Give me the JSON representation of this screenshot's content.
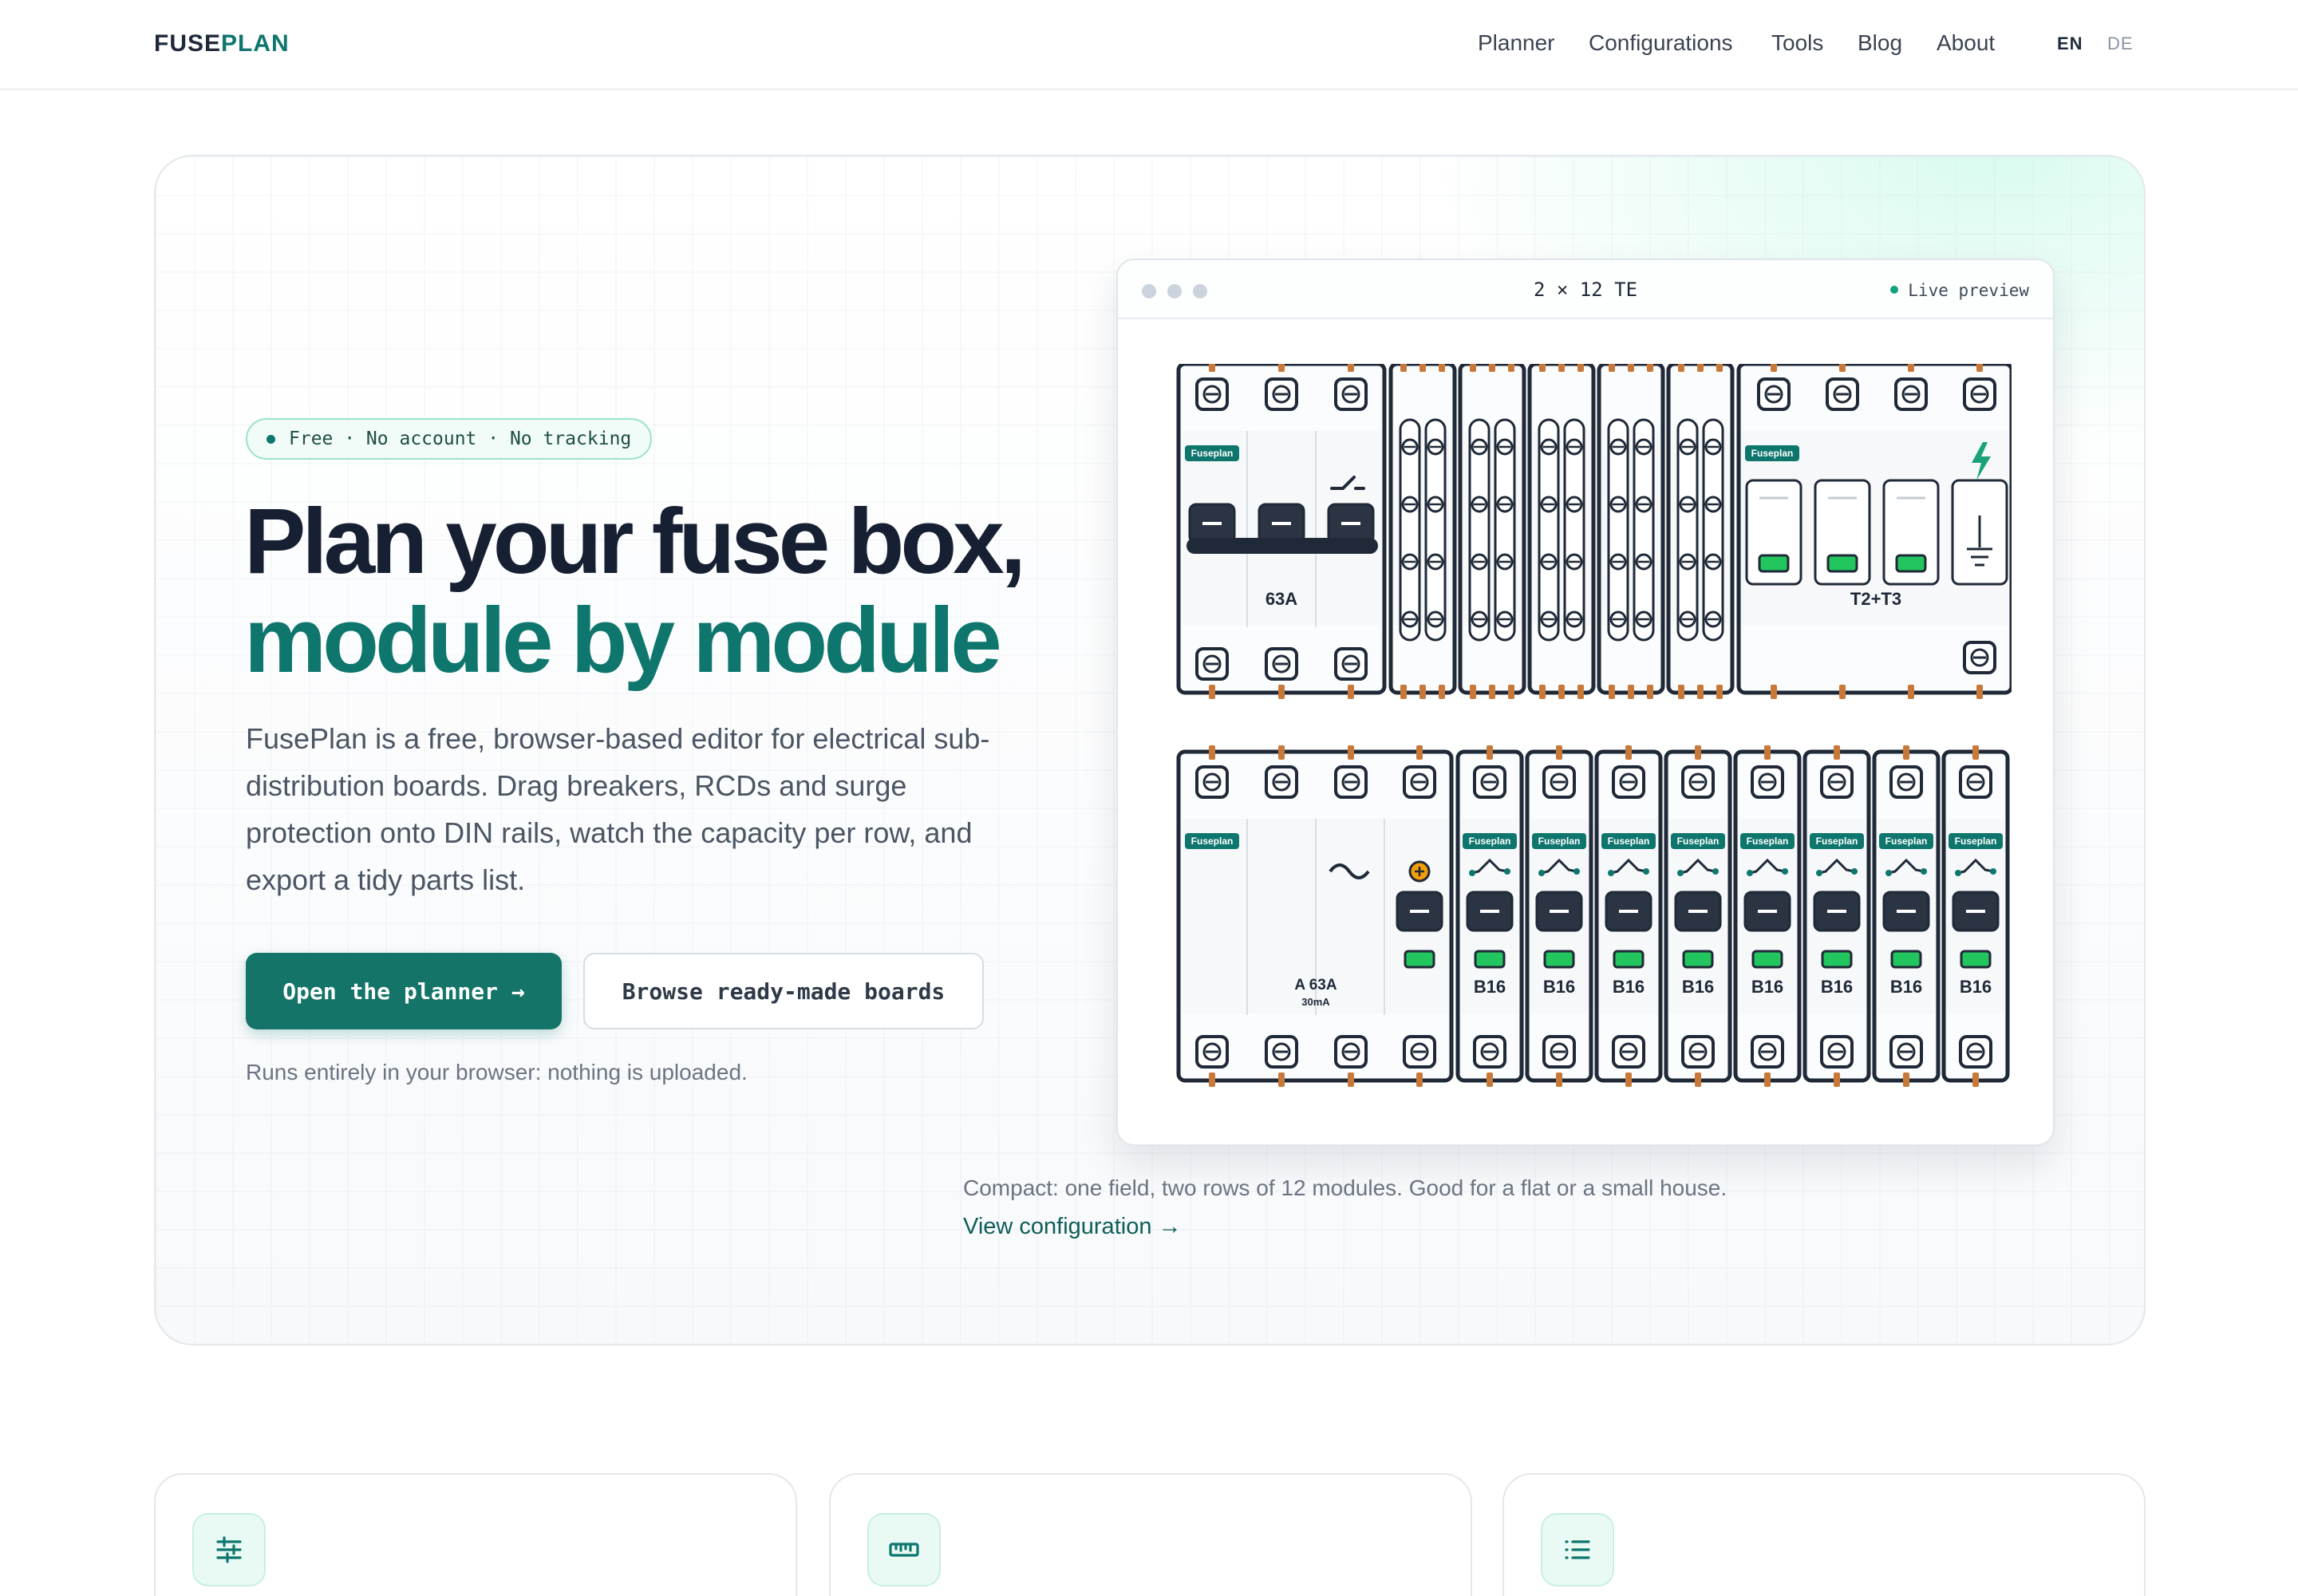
{
  "header": {
    "logo_left": "FUSE",
    "logo_right": "PLAN",
    "nav": [
      "Planner",
      "Configurations",
      "Tools",
      "Blog",
      "About"
    ],
    "lang": [
      "EN",
      "DE"
    ]
  },
  "hero": {
    "badge": "Free · No account · No tracking",
    "title_line1": "Plan your fuse box,",
    "title_line2": "module by module",
    "lead": "FusePlan is a free, browser-based editor for electrical sub-distribution boards. Drag breakers, RCDs and surge protection onto DIN rails, watch the capacity per row, and export a tidy parts list.",
    "primary_button": "Open the planner →",
    "secondary_button": "Browse ready-made boards",
    "note": "Runs entirely in your browser: nothing is uploaded."
  },
  "preview": {
    "title": "2 × 12 TE",
    "live_label": "Live preview",
    "brand_label": "Fuseplan",
    "row1": {
      "main_switch": "63A",
      "surge": "T2+T3"
    },
    "row2": {
      "rcd_rating": "A 63A",
      "rcd_sensitivity": "30mA",
      "breakers": [
        "B16",
        "B16",
        "B16",
        "B16",
        "B16",
        "B16",
        "B16",
        "B16"
      ]
    },
    "caption": "Compact: one field, two rows of 12 modules. Good for a flat or a small house.",
    "link": "View configuration →"
  },
  "features": {
    "icons": [
      "sliders-icon",
      "ruler-icon",
      "list-icon"
    ]
  },
  "colors": {
    "accent": "#0f766e",
    "accent_light": "#e9faf4",
    "breaker_green": "#22c55e",
    "terminal_copper": "#c8793a",
    "outline": "#1f2937"
  }
}
